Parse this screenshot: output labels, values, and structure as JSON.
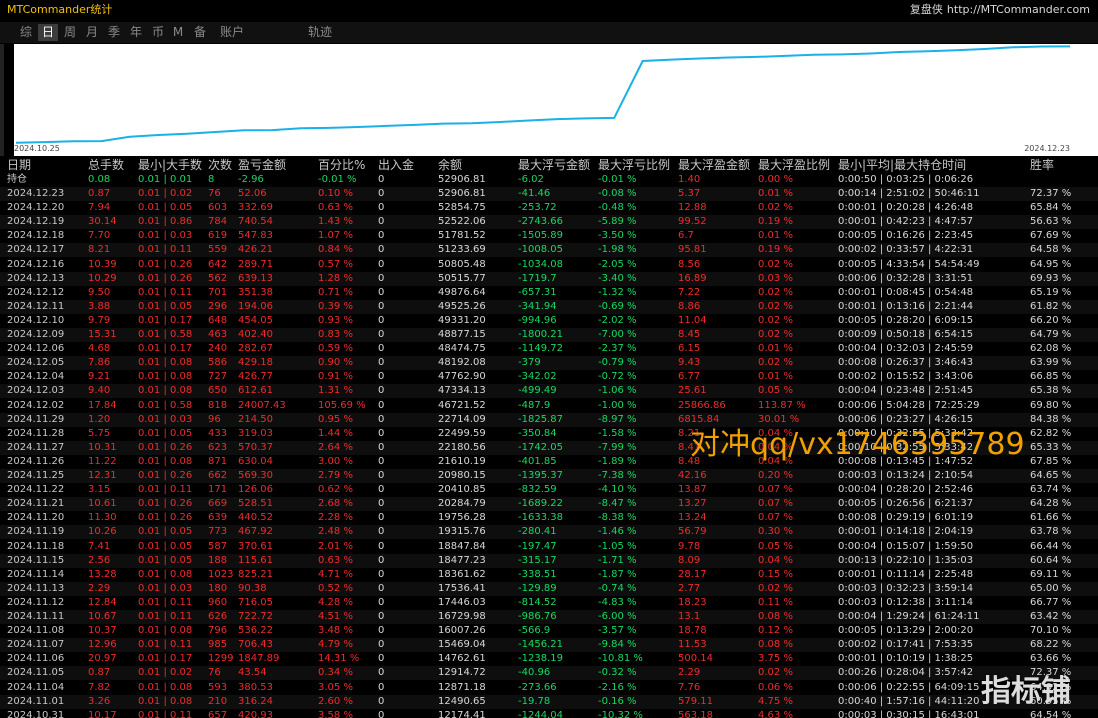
{
  "app_title": "MTCommander统计",
  "brand": {
    "name": "复盘侠",
    "url": "http://MTCommander.com"
  },
  "tabs": [
    "综",
    "日",
    "周",
    "月",
    "季",
    "年",
    "币",
    "M",
    "备",
    "账户",
    "轨迹"
  ],
  "active_tab": "日",
  "chart": {
    "start_date": "2024.10.25",
    "end_date": "2024.12.23",
    "line_color": "#1ab0e8"
  },
  "headers": [
    "日期",
    "总手数",
    "最小|大手数",
    "次数",
    "盈亏金额",
    "百分比%",
    "出入金",
    "余额",
    "最大浮亏金额",
    "最大浮亏比例",
    "最大浮盈金额",
    "最大浮盈比例",
    "最小|平均|最大持仓时间",
    "胜率"
  ],
  "hold_row": [
    "持仓",
    "0.08",
    "0.01 | 0.01",
    "8",
    "-2.96",
    "-0.01 %",
    "0",
    "52906.81",
    "-6.02",
    "-0.01 %",
    "1.40",
    "0.00 %",
    "0:00:50 | 0:03:25 | 0:06:26",
    ""
  ],
  "rows": [
    [
      "2024.12.23",
      "0.87",
      "0.01 | 0.02",
      "76",
      "52.06",
      "0.10 %",
      "0",
      "52906.81",
      "-41.46",
      "-0.08 %",
      "5.37",
      "0.01 %",
      "0:00:14 | 2:51:02 | 50:46:11",
      "72.37 %"
    ],
    [
      "2024.12.20",
      "7.94",
      "0.01 | 0.05",
      "603",
      "332.69",
      "0.63 %",
      "0",
      "52854.75",
      "-253.72",
      "-0.48 %",
      "12.88",
      "0.02 %",
      "0:00:01 | 0:20:28 | 4:26:48",
      "65.84 %"
    ],
    [
      "2024.12.19",
      "30.14",
      "0.01 | 0.86",
      "784",
      "740.54",
      "1.43 %",
      "0",
      "52522.06",
      "-2743.66",
      "-5.89 %",
      "99.52",
      "0.19 %",
      "0:00:01 | 0:42:23 | 4:47:57",
      "56.63 %"
    ],
    [
      "2024.12.18",
      "7.70",
      "0.01 | 0.03",
      "619",
      "547.83",
      "1.07 %",
      "0",
      "51781.52",
      "-1505.89",
      "-3.50 %",
      "6.7",
      "0.01 %",
      "0:00:05 | 0:16:26 | 2:23:45",
      "67.69 %"
    ],
    [
      "2024.12.17",
      "8.21",
      "0.01 | 0.11",
      "559",
      "426.21",
      "0.84 %",
      "0",
      "51233.69",
      "-1008.05",
      "-1.98 %",
      "95.81",
      "0.19 %",
      "0:00:02 | 0:33:57 | 4:22:31",
      "64.58 %"
    ],
    [
      "2024.12.16",
      "10.39",
      "0.01 | 0.26",
      "642",
      "289.71",
      "0.57 %",
      "0",
      "50805.48",
      "-1034.08",
      "-2.05 %",
      "8.56",
      "0.02 %",
      "0:00:05 | 4:33:54 | 54:54:49",
      "64.95 %"
    ],
    [
      "2024.12.13",
      "10.29",
      "0.01 | 0.26",
      "562",
      "639.13",
      "1.28 %",
      "0",
      "50515.77",
      "-1719.7",
      "-3.40 %",
      "16.89",
      "0.03 %",
      "0:00:06 | 0:32:28 | 3:31:51",
      "69.93 %"
    ],
    [
      "2024.12.12",
      "9.50",
      "0.01 | 0.11",
      "701",
      "351.38",
      "0.71 %",
      "0",
      "49876.64",
      "-657.31",
      "-1.32 %",
      "7.22",
      "0.02 %",
      "0:00:01 | 0:08:45 | 0:54:48",
      "65.19 %"
    ],
    [
      "2024.12.11",
      "3.88",
      "0.01 | 0.05",
      "296",
      "194.06",
      "0.39 %",
      "0",
      "49525.26",
      "-341.94",
      "-0.69 %",
      "8.86",
      "0.02 %",
      "0:00:01 | 0:13:16 | 2:21:44",
      "61.82 %"
    ],
    [
      "2024.12.10",
      "9.79",
      "0.01 | 0.17",
      "648",
      "454.05",
      "0.93 %",
      "0",
      "49331.20",
      "-994.96",
      "-2.02 %",
      "11.04",
      "0.02 %",
      "0:00:05 | 0:28:20 | 6:09:15",
      "66.20 %"
    ],
    [
      "2024.12.09",
      "15.31",
      "0.01 | 0.58",
      "463",
      "402.40",
      "0.83 %",
      "0",
      "48877.15",
      "-1800.21",
      "-7.00 %",
      "8.45",
      "0.02 %",
      "0:00:09 | 0:50:18 | 6:54:15",
      "64.79 %"
    ],
    [
      "2024.12.06",
      "4.68",
      "0.01 | 0.17",
      "240",
      "282.67",
      "0.59 %",
      "0",
      "48474.75",
      "-1149.72",
      "-2.37 %",
      "6.15",
      "0.01 %",
      "0:00:04 | 0:32:03 | 2:45:59",
      "62.08 %"
    ],
    [
      "2024.12.05",
      "7.86",
      "0.01 | 0.08",
      "586",
      "429.18",
      "0.90 %",
      "0",
      "48192.08",
      "-379",
      "-0.79 %",
      "9.43",
      "0.02 %",
      "0:00:08 | 0:26:37 | 3:46:43",
      "63.99 %"
    ],
    [
      "2024.12.04",
      "9.21",
      "0.01 | 0.08",
      "727",
      "426.77",
      "0.91 %",
      "0",
      "47762.90",
      "-342.02",
      "-0.72 %",
      "6.77",
      "0.01 %",
      "0:00:02 | 0:15:52 | 3:43:06",
      "66.85 %"
    ],
    [
      "2024.12.03",
      "9.40",
      "0.01 | 0.08",
      "650",
      "612.61",
      "1.31 %",
      "0",
      "47334.13",
      "-499.49",
      "-1.06 %",
      "25.61",
      "0.05 %",
      "0:00:04 | 0:23:48 | 2:51:45",
      "65.38 %"
    ],
    [
      "2024.12.02",
      "17.84",
      "0.01 | 0.58",
      "818",
      "24007.43",
      "105.69 %",
      "0",
      "46721.52",
      "-487.9",
      "-1.00 %",
      "25866.86",
      "113.87 %",
      "0:00:06 | 5:04:28 | 72:25:29",
      "69.80 %"
    ],
    [
      "2024.11.29",
      "1.20",
      "0.01 | 0.03",
      "96",
      "214.50",
      "0.95 %",
      "0",
      "22714.09",
      "-1825.87",
      "-8.97 %",
      "6815.84",
      "30.01 %",
      "0:00:06 | 0:23:27 | 4:26:15",
      "84.38 %"
    ],
    [
      "2024.11.28",
      "5.75",
      "0.01 | 0.05",
      "433",
      "319.03",
      "1.44 %",
      "0",
      "22499.59",
      "-350.84",
      "-1.58 %",
      "8.21",
      "0.04 %",
      "0:00:10 | 0:32:55 | 5:33:42",
      "62.82 %"
    ],
    [
      "2024.11.27",
      "10.31",
      "0.01 | 0.26",
      "623",
      "570.37",
      "2.64 %",
      "0",
      "22180.56",
      "-1742.05",
      "-7.99 %",
      "8.41",
      "0.04 %",
      "0:00:10 | 0:32:55 | 5:33:42",
      "65.33 %"
    ],
    [
      "2024.11.26",
      "11.22",
      "0.01 | 0.08",
      "871",
      "630.04",
      "3.00 %",
      "0",
      "21610.19",
      "-401.85",
      "-1.89 %",
      "8.48",
      "0.04 %",
      "0:00:08 | 0:13:45 | 1:47:52",
      "67.85 %"
    ],
    [
      "2024.11.25",
      "12.31",
      "0.01 | 0.26",
      "662",
      "569.30",
      "2.79 %",
      "0",
      "20980.15",
      "-1395.37",
      "-7.38 %",
      "42.16",
      "0.20 %",
      "0:00:03 | 0:13:24 | 2:10:54",
      "64.65 %"
    ],
    [
      "2024.11.22",
      "3.15",
      "0.01 | 0.11",
      "171",
      "126.06",
      "0.62 %",
      "0",
      "20410.85",
      "-832.59",
      "-4.10 %",
      "13.87",
      "0.07 %",
      "0:00:04 | 0:28:20 | 2:52:46",
      "63.74 %"
    ],
    [
      "2024.11.21",
      "10.61",
      "0.01 | 0.26",
      "669",
      "528.51",
      "2.68 %",
      "0",
      "20284.79",
      "-1689.22",
      "-8.47 %",
      "13.27",
      "0.07 %",
      "0:00:05 | 0:26:56 | 6:21:37",
      "64.28 %"
    ],
    [
      "2024.11.20",
      "11.30",
      "0.01 | 0.26",
      "639",
      "440.52",
      "2.28 %",
      "0",
      "19756.28",
      "-1633.38",
      "-8.38 %",
      "13.24",
      "0.07 %",
      "0:00:08 | 0:29:19 | 6:01:19",
      "61.66 %"
    ],
    [
      "2024.11.19",
      "10.26",
      "0.01 | 0.05",
      "773",
      "467.92",
      "2.48 %",
      "0",
      "19315.76",
      "-280.41",
      "-1.46 %",
      "56.79",
      "0.30 %",
      "0:00:01 | 0:14:18 | 2:04:19",
      "63.78 %"
    ],
    [
      "2024.11.18",
      "7.41",
      "0.01 | 0.05",
      "587",
      "370.61",
      "2.01 %",
      "0",
      "18847.84",
      "-197.47",
      "-1.05 %",
      "9.78",
      "0.05 %",
      "0:00:04 | 0:15:07 | 1:59:50",
      "66.44 %"
    ],
    [
      "2024.11.15",
      "2.56",
      "0.01 | 0.05",
      "188",
      "115.61",
      "0.63 %",
      "0",
      "18477.23",
      "-315.17",
      "-1.71 %",
      "8.09",
      "0.04 %",
      "0:00:13 | 0:22:10 | 1:35:03",
      "60.64 %"
    ],
    [
      "2024.11.14",
      "13.28",
      "0.01 | 0.08",
      "1023",
      "825.21",
      "4.71 %",
      "0",
      "18361.62",
      "-338.51",
      "-1.87 %",
      "28.17",
      "0.15 %",
      "0:00:01 | 0:11:14 | 2:25:48",
      "69.11 %"
    ],
    [
      "2024.11.13",
      "2.29",
      "0.01 | 0.03",
      "180",
      "90.38",
      "0.52 %",
      "0",
      "17536.41",
      "-129.89",
      "-0.74 %",
      "2.77",
      "0.02 %",
      "0:00:03 | 0:32:23 | 3:59:14",
      "65.00 %"
    ],
    [
      "2024.11.12",
      "12.84",
      "0.01 | 0.11",
      "960",
      "716.05",
      "4.28 %",
      "0",
      "17446.03",
      "-814.52",
      "-4.83 %",
      "18.23",
      "0.11 %",
      "0:00:03 | 0:12:38 | 3:11:14",
      "66.77 %"
    ],
    [
      "2024.11.11",
      "10.67",
      "0.01 | 0.11",
      "626",
      "722.72",
      "4.51 %",
      "0",
      "16729.98",
      "-986.76",
      "-6.00 %",
      "13.1",
      "0.08 %",
      "0:00:04 | 1:29:24 | 61:24:11",
      "63.42 %"
    ],
    [
      "2024.11.08",
      "10.37",
      "0.01 | 0.08",
      "796",
      "536.22",
      "3.48 %",
      "0",
      "16007.26",
      "-566.9",
      "-3.57 %",
      "18.78",
      "0.12 %",
      "0:00:05 | 0:13:29 | 2:00:20",
      "70.10 %"
    ],
    [
      "2024.11.07",
      "12.96",
      "0.01 | 0.11",
      "985",
      "706.43",
      "4.79 %",
      "0",
      "15469.04",
      "-1456.21",
      "-9.84 %",
      "11.53",
      "0.08 %",
      "0:00:02 | 0:17:41 | 7:53:35",
      "68.22 %"
    ],
    [
      "2024.11.06",
      "20.97",
      "0.01 | 0.17",
      "1299",
      "1847.89",
      "14.31 %",
      "0",
      "14762.61",
      "-1238.19",
      "-10.81 %",
      "500.14",
      "3.75 %",
      "0:00:01 | 0:10:19 | 1:38:25",
      "63.66 %"
    ],
    [
      "2024.11.05",
      "0.87",
      "0.01 | 0.02",
      "76",
      "43.54",
      "0.34 %",
      "0",
      "12914.72",
      "-40.96",
      "-0.32 %",
      "2.29",
      "0.02 %",
      "0:00:26 | 0:28:04 | 3:57:42",
      "72.37 %"
    ],
    [
      "2024.11.04",
      "7.82",
      "0.01 | 0.08",
      "593",
      "380.53",
      "3.05 %",
      "0",
      "12871.18",
      "-273.66",
      "-2.16 %",
      "7.76",
      "0.06 %",
      "0:00:06 | 0:22:55 | 64:09:15",
      "64.92 %"
    ],
    [
      "2024.11.01",
      "3.26",
      "0.01 | 0.08",
      "210",
      "316.24",
      "2.60 %",
      "0",
      "12490.65",
      "-19.78",
      "-0.16 %",
      "579.11",
      "4.75 %",
      "0:00:40 | 1:57:16 | 44:11:20",
      "60.95 %"
    ],
    [
      "2024.10.31",
      "10.17",
      "0.01 | 0.11",
      "657",
      "420.93",
      "3.58 %",
      "0",
      "12174.41",
      "-1244.04",
      "-10.32 %",
      "563.18",
      "4.63 %",
      "0:00:03 | 0:30:15 | 16:43:01",
      "64.54 %"
    ]
  ],
  "watermark": "对冲qq/vx1746395789",
  "corner_logo": "指标铺",
  "colors": {
    "positive": "#18d860",
    "negative": "#ef2c2c",
    "title": "#f2c200",
    "text": "#c8c8c8"
  }
}
